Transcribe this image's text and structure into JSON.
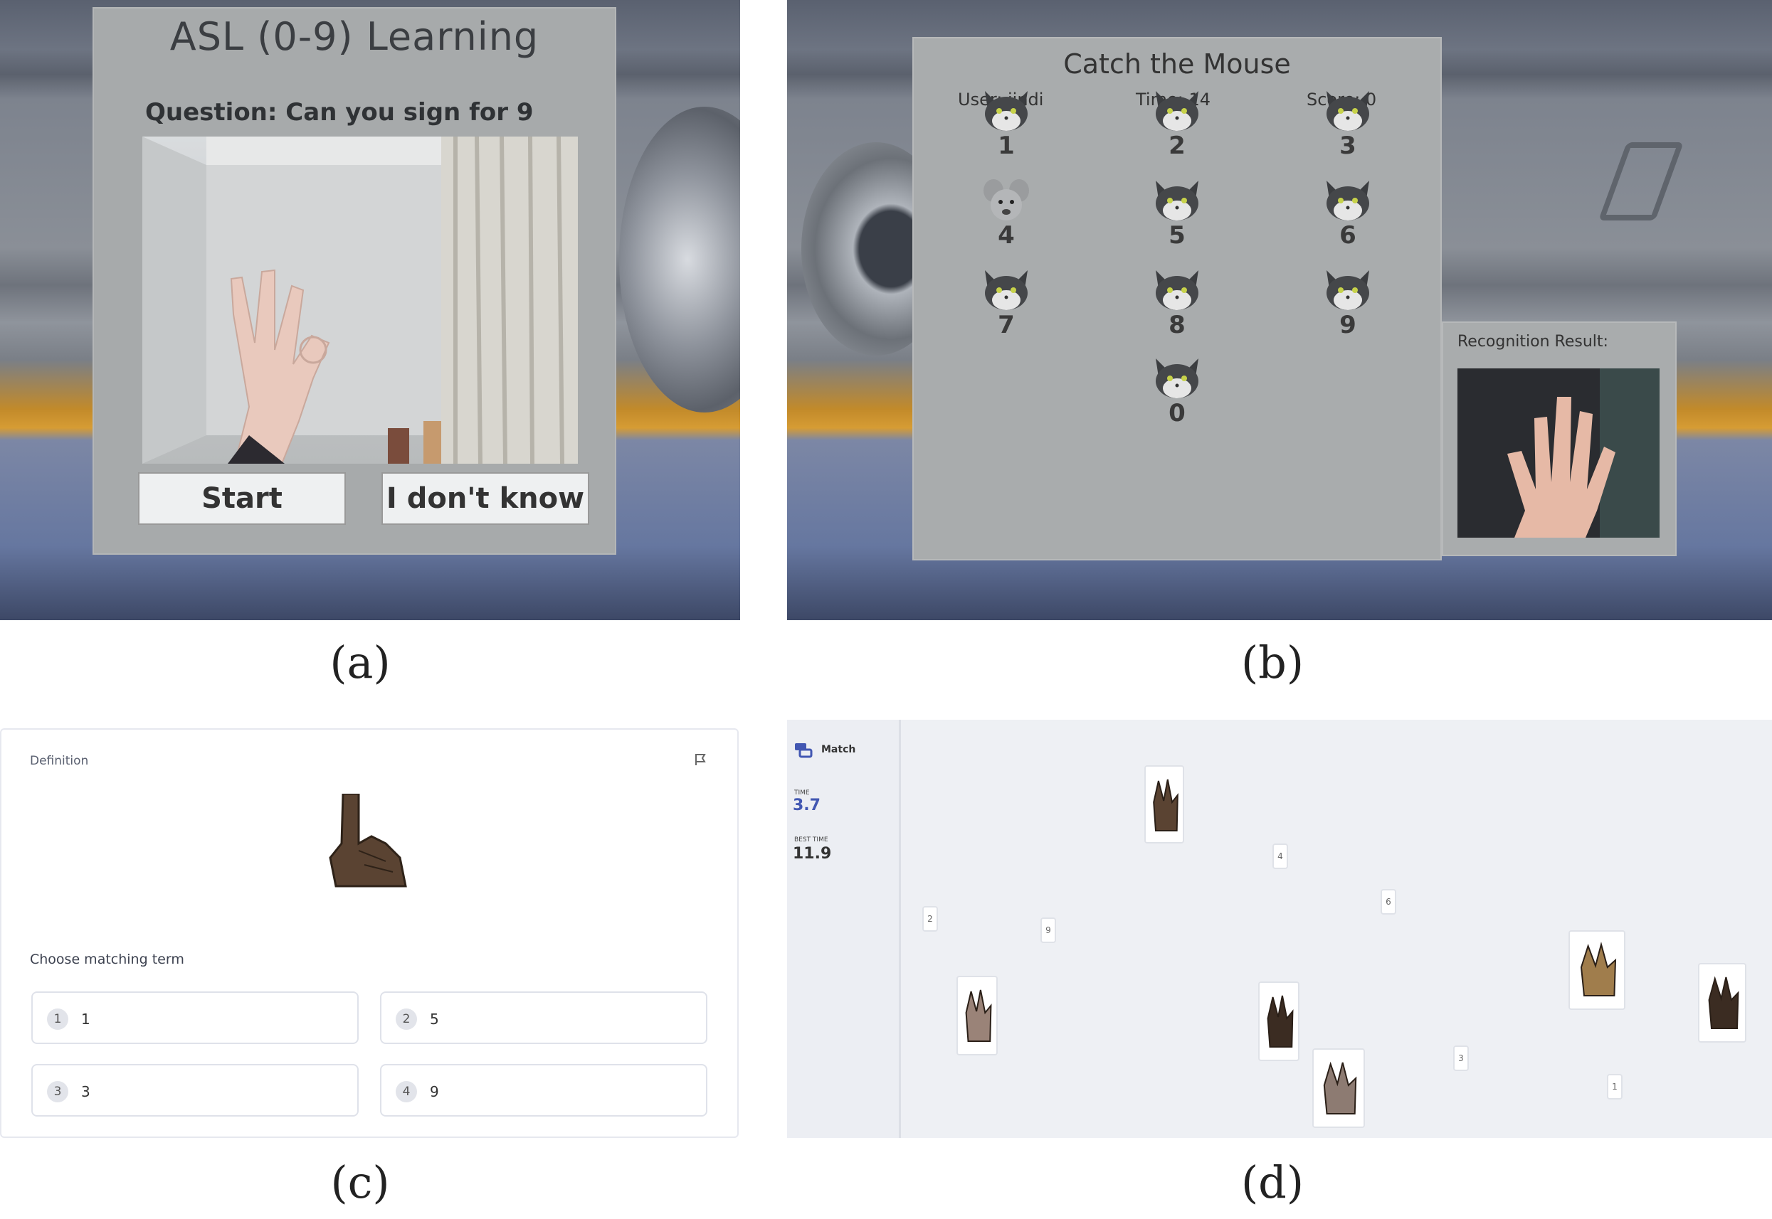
{
  "panel_a": {
    "title": "ASL (0-9) Learning",
    "question": "Question: Can you sign for 9",
    "start_button": "Start",
    "dont_know_button": "I don't know",
    "caption": "(a)"
  },
  "panel_b": {
    "title": "Catch the Mouse",
    "user": "User: jindi",
    "time": "Time: 14",
    "score": "Score: 0",
    "cells": [
      "1",
      "2",
      "3",
      "4",
      "5",
      "6",
      "7",
      "8",
      "9",
      "0"
    ],
    "mouse_cell": "4",
    "recognition_label": "Recognition Result:",
    "caption": "(b)"
  },
  "panel_c": {
    "definition_label": "Definition",
    "choose_label": "Choose matching term",
    "options": [
      {
        "index": "1",
        "label": "1"
      },
      {
        "index": "2",
        "label": "5"
      },
      {
        "index": "3",
        "label": "3"
      },
      {
        "index": "4",
        "label": "9"
      }
    ],
    "caption": "(c)"
  },
  "panel_d": {
    "mode_label": "Match",
    "time_label": "TIME",
    "time_value": "3.7",
    "best_time_label": "BEST TIME",
    "best_time_value": "11.9",
    "number_cards": [
      "4",
      "6",
      "2",
      "9",
      "3",
      "1"
    ],
    "caption": "(d)"
  },
  "colors": {
    "accent_blue": "#4257b2",
    "vr_panel": "#a7aaab"
  },
  "icons": [
    "flag-icon",
    "match-icon",
    "cat-face-icon",
    "mouse-face-icon",
    "hand-sign-icon"
  ]
}
